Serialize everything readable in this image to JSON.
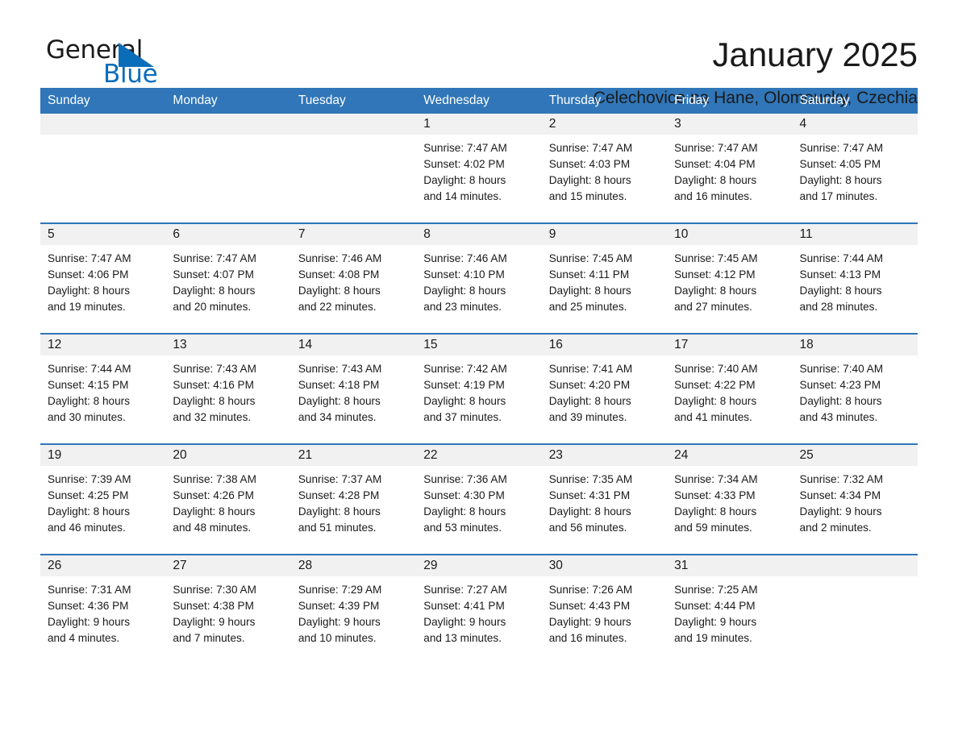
{
  "brand": {
    "name_part1": "General",
    "name_part2": "Blue",
    "logo_icon": "triangle-flag-icon",
    "accent_color": "#0a6dba"
  },
  "header": {
    "title": "January 2025",
    "subtitle": "Celechovice na Hane, Olomoucky, Czechia"
  },
  "calendar": {
    "header_bg": "#3076b8",
    "row_divider_color": "#2f75b7",
    "daynum_band_bg": "#f1f1f1",
    "weekday_headers": [
      "Sunday",
      "Monday",
      "Tuesday",
      "Wednesday",
      "Thursday",
      "Friday",
      "Saturday"
    ],
    "weeks": [
      [
        {
          "day": "",
          "sunrise": "",
          "sunset": "",
          "daylight_line1": "",
          "daylight_line2": ""
        },
        {
          "day": "",
          "sunrise": "",
          "sunset": "",
          "daylight_line1": "",
          "daylight_line2": ""
        },
        {
          "day": "",
          "sunrise": "",
          "sunset": "",
          "daylight_line1": "",
          "daylight_line2": ""
        },
        {
          "day": "1",
          "sunrise": "Sunrise: 7:47 AM",
          "sunset": "Sunset: 4:02 PM",
          "daylight_line1": "Daylight: 8 hours",
          "daylight_line2": "and 14 minutes."
        },
        {
          "day": "2",
          "sunrise": "Sunrise: 7:47 AM",
          "sunset": "Sunset: 4:03 PM",
          "daylight_line1": "Daylight: 8 hours",
          "daylight_line2": "and 15 minutes."
        },
        {
          "day": "3",
          "sunrise": "Sunrise: 7:47 AM",
          "sunset": "Sunset: 4:04 PM",
          "daylight_line1": "Daylight: 8 hours",
          "daylight_line2": "and 16 minutes."
        },
        {
          "day": "4",
          "sunrise": "Sunrise: 7:47 AM",
          "sunset": "Sunset: 4:05 PM",
          "daylight_line1": "Daylight: 8 hours",
          "daylight_line2": "and 17 minutes."
        }
      ],
      [
        {
          "day": "5",
          "sunrise": "Sunrise: 7:47 AM",
          "sunset": "Sunset: 4:06 PM",
          "daylight_line1": "Daylight: 8 hours",
          "daylight_line2": "and 19 minutes."
        },
        {
          "day": "6",
          "sunrise": "Sunrise: 7:47 AM",
          "sunset": "Sunset: 4:07 PM",
          "daylight_line1": "Daylight: 8 hours",
          "daylight_line2": "and 20 minutes."
        },
        {
          "day": "7",
          "sunrise": "Sunrise: 7:46 AM",
          "sunset": "Sunset: 4:08 PM",
          "daylight_line1": "Daylight: 8 hours",
          "daylight_line2": "and 22 minutes."
        },
        {
          "day": "8",
          "sunrise": "Sunrise: 7:46 AM",
          "sunset": "Sunset: 4:10 PM",
          "daylight_line1": "Daylight: 8 hours",
          "daylight_line2": "and 23 minutes."
        },
        {
          "day": "9",
          "sunrise": "Sunrise: 7:45 AM",
          "sunset": "Sunset: 4:11 PM",
          "daylight_line1": "Daylight: 8 hours",
          "daylight_line2": "and 25 minutes."
        },
        {
          "day": "10",
          "sunrise": "Sunrise: 7:45 AM",
          "sunset": "Sunset: 4:12 PM",
          "daylight_line1": "Daylight: 8 hours",
          "daylight_line2": "and 27 minutes."
        },
        {
          "day": "11",
          "sunrise": "Sunrise: 7:44 AM",
          "sunset": "Sunset: 4:13 PM",
          "daylight_line1": "Daylight: 8 hours",
          "daylight_line2": "and 28 minutes."
        }
      ],
      [
        {
          "day": "12",
          "sunrise": "Sunrise: 7:44 AM",
          "sunset": "Sunset: 4:15 PM",
          "daylight_line1": "Daylight: 8 hours",
          "daylight_line2": "and 30 minutes."
        },
        {
          "day": "13",
          "sunrise": "Sunrise: 7:43 AM",
          "sunset": "Sunset: 4:16 PM",
          "daylight_line1": "Daylight: 8 hours",
          "daylight_line2": "and 32 minutes."
        },
        {
          "day": "14",
          "sunrise": "Sunrise: 7:43 AM",
          "sunset": "Sunset: 4:18 PM",
          "daylight_line1": "Daylight: 8 hours",
          "daylight_line2": "and 34 minutes."
        },
        {
          "day": "15",
          "sunrise": "Sunrise: 7:42 AM",
          "sunset": "Sunset: 4:19 PM",
          "daylight_line1": "Daylight: 8 hours",
          "daylight_line2": "and 37 minutes."
        },
        {
          "day": "16",
          "sunrise": "Sunrise: 7:41 AM",
          "sunset": "Sunset: 4:20 PM",
          "daylight_line1": "Daylight: 8 hours",
          "daylight_line2": "and 39 minutes."
        },
        {
          "day": "17",
          "sunrise": "Sunrise: 7:40 AM",
          "sunset": "Sunset: 4:22 PM",
          "daylight_line1": "Daylight: 8 hours",
          "daylight_line2": "and 41 minutes."
        },
        {
          "day": "18",
          "sunrise": "Sunrise: 7:40 AM",
          "sunset": "Sunset: 4:23 PM",
          "daylight_line1": "Daylight: 8 hours",
          "daylight_line2": "and 43 minutes."
        }
      ],
      [
        {
          "day": "19",
          "sunrise": "Sunrise: 7:39 AM",
          "sunset": "Sunset: 4:25 PM",
          "daylight_line1": "Daylight: 8 hours",
          "daylight_line2": "and 46 minutes."
        },
        {
          "day": "20",
          "sunrise": "Sunrise: 7:38 AM",
          "sunset": "Sunset: 4:26 PM",
          "daylight_line1": "Daylight: 8 hours",
          "daylight_line2": "and 48 minutes."
        },
        {
          "day": "21",
          "sunrise": "Sunrise: 7:37 AM",
          "sunset": "Sunset: 4:28 PM",
          "daylight_line1": "Daylight: 8 hours",
          "daylight_line2": "and 51 minutes."
        },
        {
          "day": "22",
          "sunrise": "Sunrise: 7:36 AM",
          "sunset": "Sunset: 4:30 PM",
          "daylight_line1": "Daylight: 8 hours",
          "daylight_line2": "and 53 minutes."
        },
        {
          "day": "23",
          "sunrise": "Sunrise: 7:35 AM",
          "sunset": "Sunset: 4:31 PM",
          "daylight_line1": "Daylight: 8 hours",
          "daylight_line2": "and 56 minutes."
        },
        {
          "day": "24",
          "sunrise": "Sunrise: 7:34 AM",
          "sunset": "Sunset: 4:33 PM",
          "daylight_line1": "Daylight: 8 hours",
          "daylight_line2": "and 59 minutes."
        },
        {
          "day": "25",
          "sunrise": "Sunrise: 7:32 AM",
          "sunset": "Sunset: 4:34 PM",
          "daylight_line1": "Daylight: 9 hours",
          "daylight_line2": "and 2 minutes."
        }
      ],
      [
        {
          "day": "26",
          "sunrise": "Sunrise: 7:31 AM",
          "sunset": "Sunset: 4:36 PM",
          "daylight_line1": "Daylight: 9 hours",
          "daylight_line2": "and 4 minutes."
        },
        {
          "day": "27",
          "sunrise": "Sunrise: 7:30 AM",
          "sunset": "Sunset: 4:38 PM",
          "daylight_line1": "Daylight: 9 hours",
          "daylight_line2": "and 7 minutes."
        },
        {
          "day": "28",
          "sunrise": "Sunrise: 7:29 AM",
          "sunset": "Sunset: 4:39 PM",
          "daylight_line1": "Daylight: 9 hours",
          "daylight_line2": "and 10 minutes."
        },
        {
          "day": "29",
          "sunrise": "Sunrise: 7:27 AM",
          "sunset": "Sunset: 4:41 PM",
          "daylight_line1": "Daylight: 9 hours",
          "daylight_line2": "and 13 minutes."
        },
        {
          "day": "30",
          "sunrise": "Sunrise: 7:26 AM",
          "sunset": "Sunset: 4:43 PM",
          "daylight_line1": "Daylight: 9 hours",
          "daylight_line2": "and 16 minutes."
        },
        {
          "day": "31",
          "sunrise": "Sunrise: 7:25 AM",
          "sunset": "Sunset: 4:44 PM",
          "daylight_line1": "Daylight: 9 hours",
          "daylight_line2": "and 19 minutes."
        },
        {
          "day": "",
          "sunrise": "",
          "sunset": "",
          "daylight_line1": "",
          "daylight_line2": ""
        }
      ]
    ]
  }
}
